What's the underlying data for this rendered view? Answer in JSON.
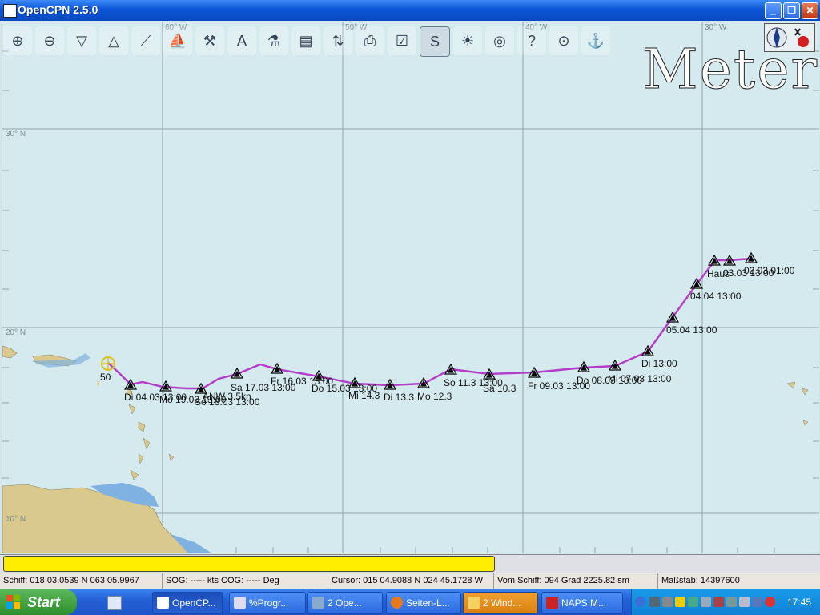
{
  "window": {
    "title": "OpenCPN 2.5.0",
    "controls": [
      "_",
      "❐",
      "✕"
    ]
  },
  "toolbar": {
    "tools": [
      {
        "name": "zoom-in-icon",
        "glyph": "⊕"
      },
      {
        "name": "zoom-out-icon",
        "glyph": "⊖"
      },
      {
        "name": "scale-in-icon",
        "glyph": "▽"
      },
      {
        "name": "scale-out-icon",
        "glyph": "△"
      },
      {
        "name": "route-icon",
        "glyph": "⟋"
      },
      {
        "name": "follow-ship-icon",
        "glyph": "⛵"
      },
      {
        "name": "settings-icon",
        "glyph": "⚒"
      },
      {
        "name": "text-icon",
        "glyph": "A"
      },
      {
        "name": "current-icon",
        "glyph": "⚗"
      },
      {
        "name": "tide-icon",
        "glyph": "▤"
      },
      {
        "name": "chart-quilt-icon",
        "glyph": "⇅"
      },
      {
        "name": "print-icon",
        "glyph": "⎙"
      },
      {
        "name": "route-manager-icon",
        "glyph": "☑"
      },
      {
        "name": "track-icon",
        "glyph": "S"
      },
      {
        "name": "day-night-icon",
        "glyph": "☀"
      },
      {
        "name": "mob-icon",
        "glyph": "◎"
      },
      {
        "name": "help-icon",
        "glyph": "?"
      },
      {
        "name": "ais-icon",
        "glyph": "⊙"
      },
      {
        "name": "tracking-icon",
        "glyph": "⚓"
      }
    ],
    "active_tool_index": 13
  },
  "overlay": {
    "units_label": "Meter"
  },
  "chart": {
    "lat_labels": [
      "30° N",
      "20° N",
      "10° N"
    ],
    "lon_labels": [
      "60° W",
      "50° W",
      "40° W",
      "30° W"
    ],
    "route_color": "#b43cc8",
    "ship_label": "50",
    "waypoints": [
      {
        "label": "Di 04.03 13:00"
      },
      {
        "label": "Mo 19.03 13:00"
      },
      {
        "label": "So 18.03 13:00"
      },
      {
        "label": "Sa 17.03 13:00"
      },
      {
        "label": "Fr 16.03 13:00"
      },
      {
        "label": "Do 15.03 13:00"
      },
      {
        "label": "Mi 14.3"
      },
      {
        "label": "Di 13.3"
      },
      {
        "label": "Mo 12.3"
      },
      {
        "label": "So 11.3 13:00"
      },
      {
        "label": "Sa 10.3"
      },
      {
        "label": "Fr 09.03 13:00"
      },
      {
        "label": "Do 08.03 13:00"
      },
      {
        "label": "Mi 07.03 13:00"
      },
      {
        "label": "Di 13:00"
      },
      {
        "label": "05.04 13:00"
      },
      {
        "label": "04.04 13:00"
      },
      {
        "label": "Haus"
      },
      {
        "label": "03.03 13:00"
      },
      {
        "label": "02.03 01:00"
      }
    ],
    "extra_label": "ANW 3.5kn"
  },
  "status": {
    "ship": "Schiff: 018 03.0539 N  063 05.9967",
    "sog": "SOG: ----- kts  COG: ----- Deg",
    "cursor": "Cursor: 015 04.9088 N 024 45.1728 W",
    "from_ship": "Vom Schiff: 094 Grad  2225.82 sm",
    "scale": "Maßstab: 14397600"
  },
  "taskbar": {
    "start": "Start",
    "tasks": [
      "OpenCP...",
      "%Progr...",
      "2 Ope...",
      "Seiten-L...",
      "2 Wind...",
      "NAPS M..."
    ],
    "clock": "17:45",
    "colors": {
      "bar": "#2461d6",
      "tray": "#1181d6",
      "start": "#3a9d38"
    }
  }
}
